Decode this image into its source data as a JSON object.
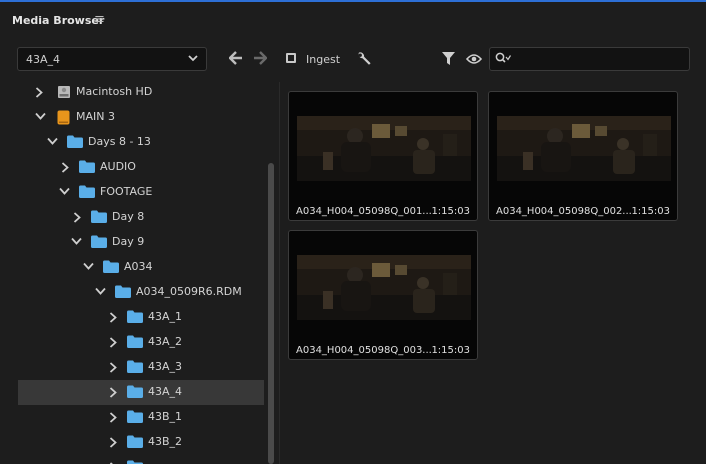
{
  "panel": {
    "title": "Media Browser",
    "menu_icon": "hamburger-menu-icon"
  },
  "toolbar": {
    "location_value": "43A_4",
    "ingest_label": "Ingest",
    "ingest_checked": false,
    "search_value": ""
  },
  "tree": [
    {
      "label": "Macintosh HD",
      "icon": "hard-drive-icon",
      "expanded": false
    },
    {
      "label": "MAIN 3",
      "icon": "external-drive-icon",
      "expanded": true
    },
    {
      "label": "Days 8 - 13",
      "icon": "folder-icon",
      "expanded": true
    },
    {
      "label": "AUDIO",
      "icon": "folder-icon",
      "expanded": false
    },
    {
      "label": "FOOTAGE",
      "icon": "folder-icon",
      "expanded": true
    },
    {
      "label": "Day 8",
      "icon": "folder-icon",
      "expanded": false
    },
    {
      "label": "Day 9",
      "icon": "folder-icon",
      "expanded": true
    },
    {
      "label": "A034",
      "icon": "folder-icon",
      "expanded": true
    },
    {
      "label": "A034_0509R6.RDM",
      "icon": "folder-icon",
      "expanded": true
    },
    {
      "label": "43A_1",
      "icon": "folder-icon",
      "expanded": false
    },
    {
      "label": "43A_2",
      "icon": "folder-icon",
      "expanded": false
    },
    {
      "label": "43A_3",
      "icon": "folder-icon",
      "expanded": false
    },
    {
      "label": "43A_4",
      "icon": "folder-icon",
      "expanded": false,
      "selected": true
    },
    {
      "label": "43B_1",
      "icon": "folder-icon",
      "expanded": false
    },
    {
      "label": "43B_2",
      "icon": "folder-icon",
      "expanded": false
    },
    {
      "label": "",
      "icon": "folder-icon",
      "expanded": false
    }
  ],
  "clips": [
    {
      "name": "A034_H004_05098Q_001...",
      "duration": "1:15:03"
    },
    {
      "name": "A034_H004_05098Q_002...",
      "duration": "1:15:03"
    },
    {
      "name": "A034_H004_05098Q_003...",
      "duration": "1:15:03"
    }
  ],
  "colors": {
    "accent": "#2d6fd6",
    "folder": "#5aaee8",
    "drive": "#e8951c",
    "selection": "#383838"
  }
}
